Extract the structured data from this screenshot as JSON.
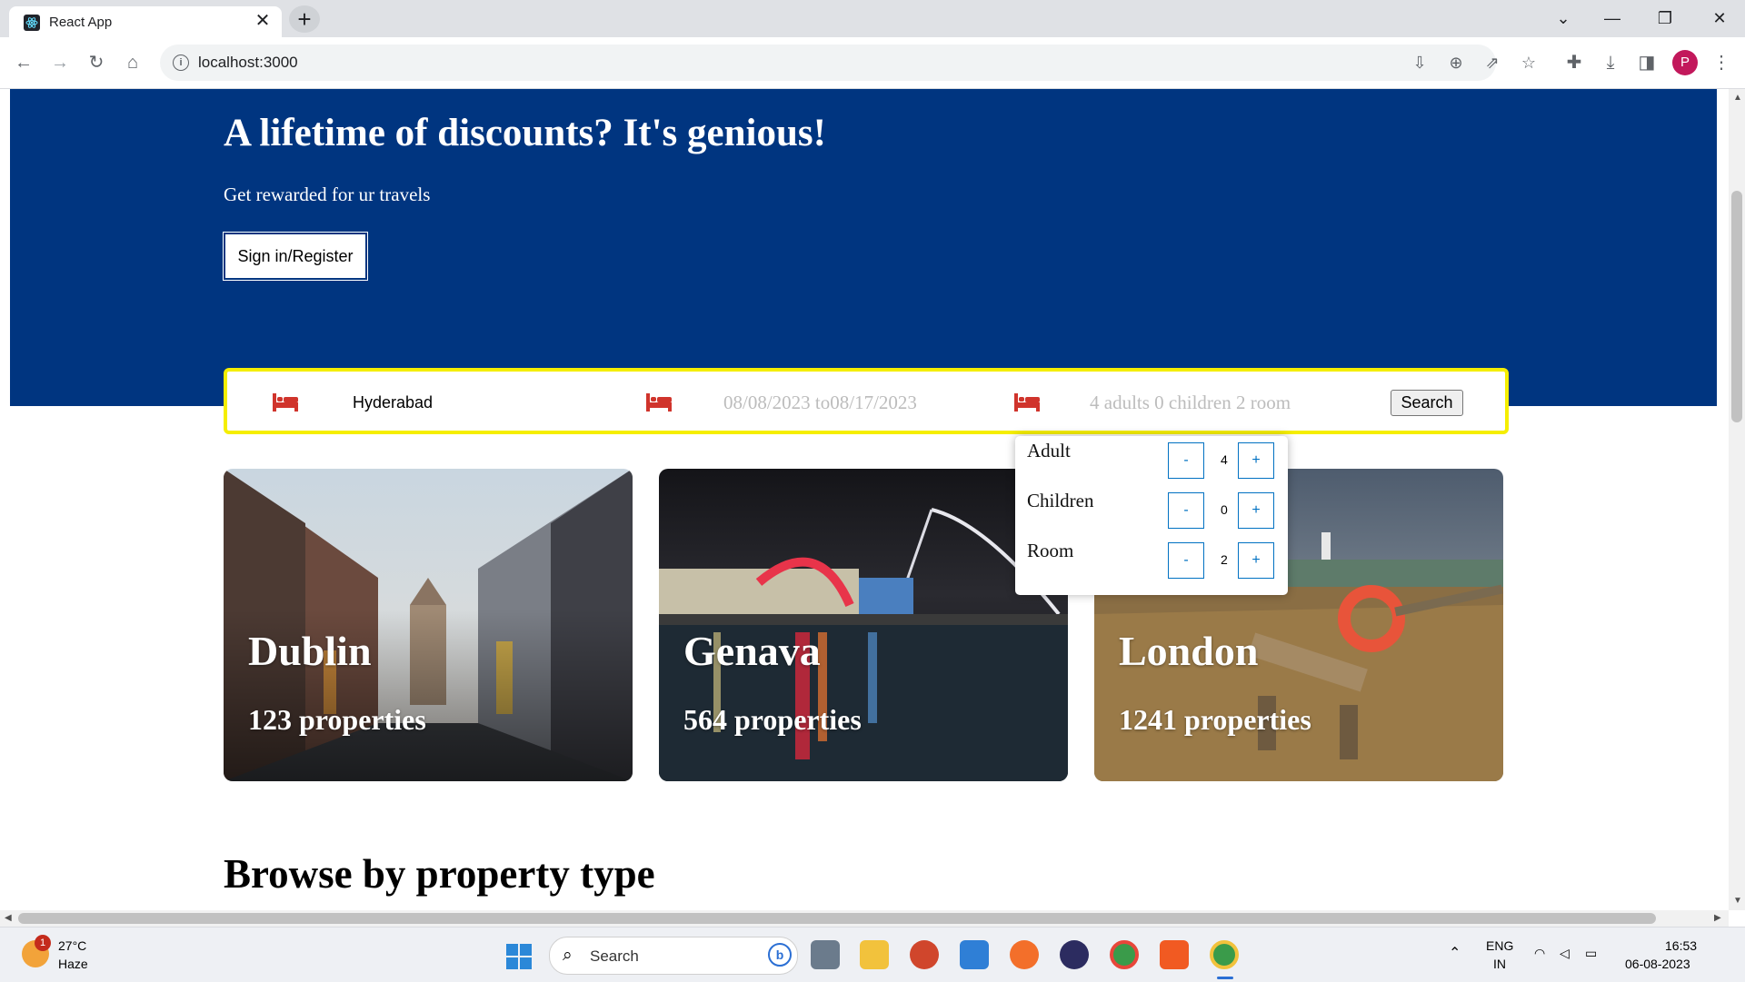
{
  "browser": {
    "tab_title": "React App",
    "url": "localhost:3000",
    "profile_initial": "P"
  },
  "header": {
    "title": "A lifetime of discounts? It's genious!",
    "subtitle": "Get rewarded for ur travels",
    "signin_label": "Sign in/Register"
  },
  "search": {
    "destination": "Hyderabad",
    "dates": "08/08/2023 to08/17/2023",
    "options_summary": "4 adults 0 children 2 room",
    "button_label": "Search"
  },
  "options": {
    "rows": [
      {
        "label": "Adult",
        "value": "4"
      },
      {
        "label": "Children",
        "value": "0"
      },
      {
        "label": "Room",
        "value": "2"
      }
    ],
    "minus": "-",
    "plus": "+"
  },
  "featured": [
    {
      "city": "Dublin",
      "properties": "123 properties"
    },
    {
      "city": "Genava",
      "properties": "564 properties"
    },
    {
      "city": "London",
      "properties": "1241 properties"
    }
  ],
  "section_title": "Browse by property type",
  "taskbar": {
    "weather_badge": "1",
    "temperature": "27°C",
    "condition": "Haze",
    "search_placeholder": "Search",
    "lang": "ENG",
    "region": "IN",
    "time": "16:53",
    "date": "06-08-2023"
  },
  "colors": {
    "header_bg": "#003580",
    "search_border": "#f5ee00",
    "bed_icon": "#d0342c",
    "counter_border": "#0071c2"
  }
}
